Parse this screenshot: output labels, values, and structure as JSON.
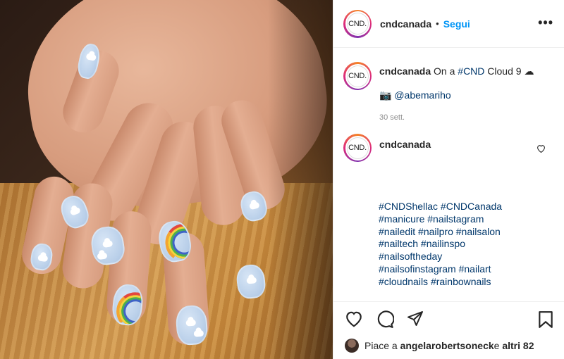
{
  "post": {
    "username": "cndcanada",
    "follow_label": "Segui",
    "separator": "•",
    "more_label": "•••",
    "avatar_text": "CND."
  },
  "caption": {
    "username": "cndcanada",
    "text_before": "On a ",
    "hashtag": "#CND",
    "text_after": " Cloud 9 ☁",
    "credit_icon": "📷",
    "credit": "@abemariho",
    "time": "30 sett."
  },
  "comment": {
    "username": "cndcanada",
    "hashtags": [
      "#CNDShellac #CNDCanada",
      "#manicure #nailstagram",
      "#nailedit #nailpro #nailsalon",
      "#nailtech #nailinspo",
      "#nailsoftheday",
      "#nailsofinstagram #nailart",
      "#cloudnails #rainbownails"
    ]
  },
  "likes": {
    "prefix": "Piace a ",
    "user": "angelarobertsoneck",
    "middle": " e ",
    "others": "altri 82"
  },
  "icons": {
    "like": "heart-icon",
    "comment": "comment-icon",
    "share": "share-icon",
    "save": "bookmark-icon"
  }
}
